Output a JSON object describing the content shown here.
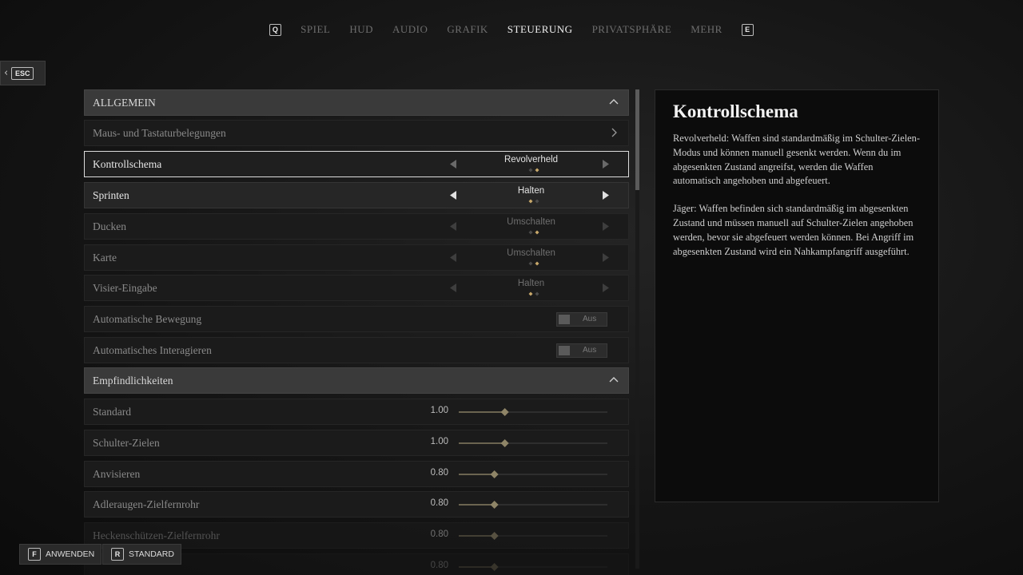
{
  "nav": {
    "left_key": "Q",
    "right_key": "E",
    "tabs": [
      {
        "label": "SPIEL",
        "active": false
      },
      {
        "label": "HUD",
        "active": false
      },
      {
        "label": "AUDIO",
        "active": false
      },
      {
        "label": "GRAFIK",
        "active": false
      },
      {
        "label": "STEUERUNG",
        "active": true
      },
      {
        "label": "PRIVATSPHÄRE",
        "active": false
      },
      {
        "label": "MEHR",
        "active": false
      }
    ]
  },
  "back": {
    "key": "ESC"
  },
  "settings": {
    "section_general": "ALLGEMEIN",
    "keybinds": "Maus- und Tastaturbelegungen",
    "control_scheme": {
      "label": "Kontrollschema",
      "value": "Revolverheld",
      "index": 1,
      "count": 2
    },
    "sprint": {
      "label": "Sprinten",
      "value": "Halten",
      "index": 0,
      "count": 2
    },
    "crouch": {
      "label": "Ducken",
      "value": "Umschalten",
      "index": 1,
      "count": 2
    },
    "map": {
      "label": "Karte",
      "value": "Umschalten",
      "index": 1,
      "count": 2
    },
    "aim_input": {
      "label": "Visier-Eingabe",
      "value": "Halten",
      "index": 0,
      "count": 2
    },
    "auto_move": {
      "label": "Automatische Bewegung",
      "value": "Aus"
    },
    "auto_interact": {
      "label": "Automatisches Interagieren",
      "value": "Aus"
    },
    "section_sensitivity": "Empfindlichkeiten",
    "sliders": [
      {
        "label": "Standard",
        "value": "1.00",
        "fraction": 0.31
      },
      {
        "label": "Schulter-Zielen",
        "value": "1.00",
        "fraction": 0.31
      },
      {
        "label": "Anvisieren",
        "value": "0.80",
        "fraction": 0.24
      },
      {
        "label": "Adleraugen-Zielfernrohr",
        "value": "0.80",
        "fraction": 0.24
      },
      {
        "label": "Heckenschützen-Zielfernrohr",
        "value": "0.80",
        "fraction": 0.24
      },
      {
        "label": "",
        "value": "0.80",
        "fraction": 0.24
      }
    ]
  },
  "info": {
    "title": "Kontrollschema",
    "p1": "Revolverheld: Waffen sind standardmäßig im Schulter-Zielen-Modus und können manuell gesenkt werden. Wenn du im abgesenkten Zustand angreifst, werden die Waffen automatisch angehoben und abgefeuert.",
    "p2": "Jäger: Waffen befinden sich standardmäßig im abgesenkten Zustand und müssen manuell auf Schulter-Zielen angehoben werden, bevor sie abgefeuert werden können. Bei Angriff im abgesenkten Zustand wird ein Nahkampfangriff ausgeführt."
  },
  "footer": {
    "apply_key": "F",
    "apply_label": "ANWENDEN",
    "default_key": "R",
    "default_label": "STANDARD"
  },
  "colors": {
    "accent_gold": "#c8a86a",
    "dot_dim": "#4a4a4a"
  }
}
